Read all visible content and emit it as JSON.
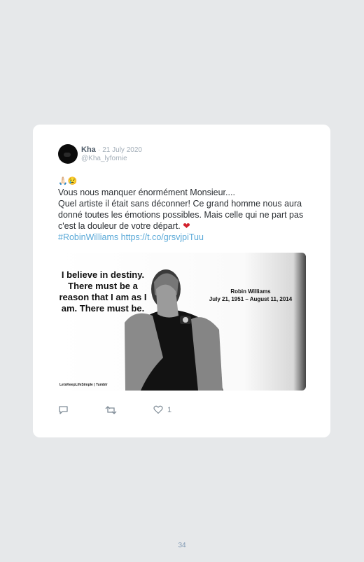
{
  "tweet": {
    "name": "Kha",
    "separator": "·",
    "date": "21 July 2020",
    "handle": "@Kha_lyfornie",
    "emojis": "🙏🏻😢",
    "lines": [
      "Vous nous manquer énormément Monsieur....",
      "Quel artiste il était sans déconner! Ce grand homme nous aura donné toutes les émotions possibles. Mais celle qui ne part pas c'est la douleur de votre départ."
    ],
    "heart": "❤",
    "hashtag": "#RobinWilliams",
    "link": "https://t.co/grsvjpiTuu",
    "like_count": "1"
  },
  "image": {
    "quote": "I believe in destiny. There must be a reason that I am as I am. There must be.",
    "name": "Robin Williams",
    "dates": "July 21, 1951 – August 11, 2014",
    "watermark": "LetsKeepLifeSimple | Tumblr"
  },
  "page": {
    "number": "34"
  }
}
